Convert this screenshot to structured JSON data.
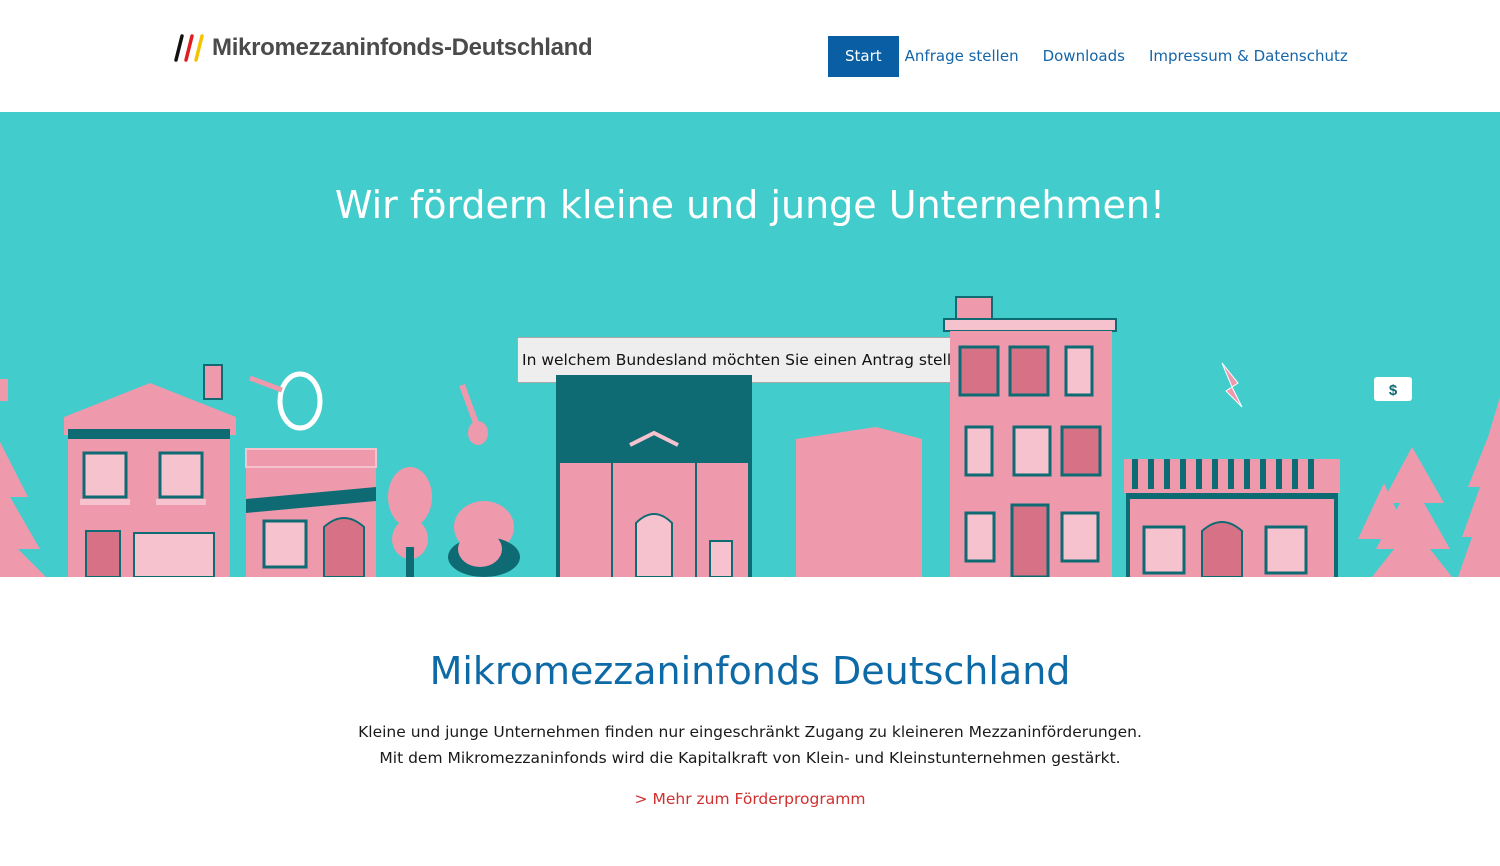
{
  "header": {
    "logo_text": "Mikromezzaninfonds-Deutschland",
    "nav": [
      {
        "label": "Start",
        "active": true
      },
      {
        "label": "Anfrage stellen",
        "active": false
      },
      {
        "label": "Downloads",
        "active": false
      },
      {
        "label": "Impressum & Datenschutz",
        "active": false
      }
    ]
  },
  "hero": {
    "title": "Wir fördern kleine und junge Unternehmen!",
    "select_value": "In welchem Bundesland möchten Sie einen Antrag stellen?",
    "illustration_sign": "$"
  },
  "intro": {
    "title": "Mikromezzaninfonds Deutschland",
    "line1": "Kleine und junge Unternehmen finden nur eingeschränkt Zugang zu kleineren Mezzaninförderungen.",
    "line2": "Mit dem Mikromezzaninfonds wird die Kapitalkraft von Klein- und Kleinstunternehmen gestärkt.",
    "link": "> Mehr zum Förderprogramm"
  },
  "colors": {
    "hero_bg": "#42cccc",
    "brand_blue": "#0a5ea3",
    "pink": "#ee9aac",
    "teal_dark": "#0f6b73",
    "link_red": "#d0302e"
  }
}
